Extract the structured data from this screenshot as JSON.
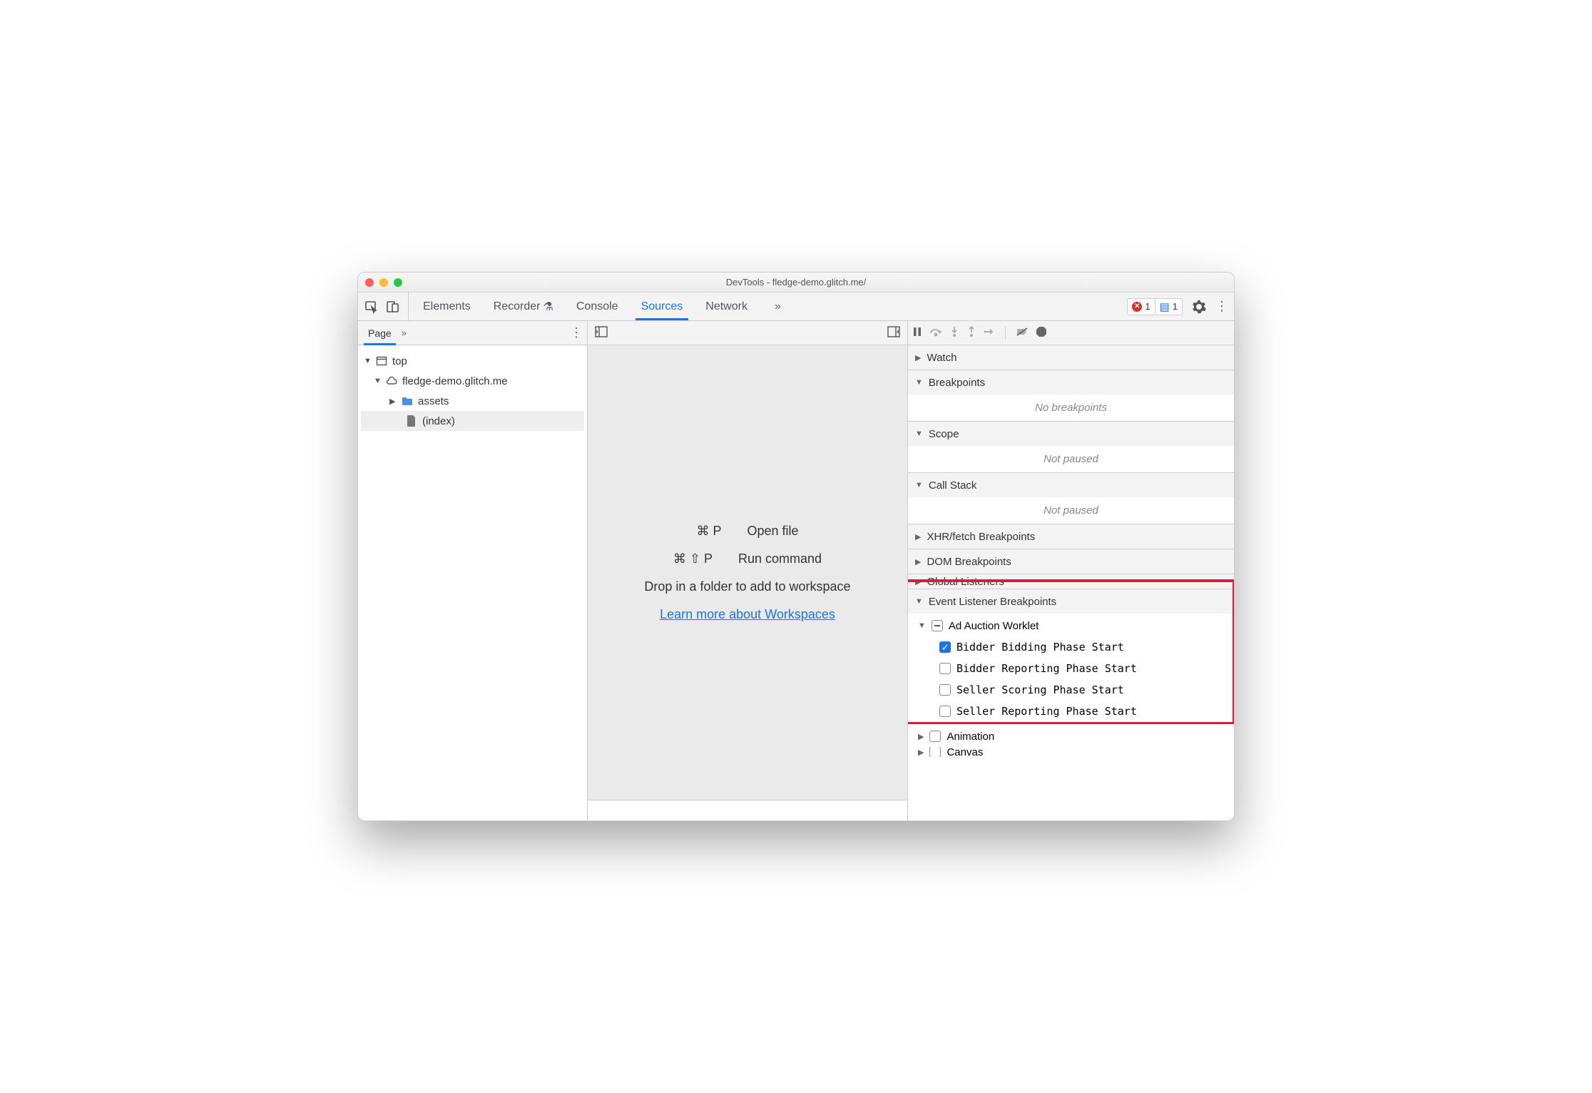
{
  "window": {
    "title": "DevTools - fledge-demo.glitch.me/"
  },
  "toolbar": {
    "tabs": [
      "Elements",
      "Recorder",
      "Console",
      "Sources",
      "Network"
    ],
    "active_tab": "Sources",
    "errors_count": "1",
    "messages_count": "1"
  },
  "left": {
    "tab": "Page",
    "tree": {
      "top": "top",
      "origin": "fledge-demo.glitch.me",
      "folder": "assets",
      "file": "(index)"
    }
  },
  "mid": {
    "open_keys": "⌘ P",
    "open_label": "Open file",
    "run_keys": "⌘ ⇧ P",
    "run_label": "Run command",
    "drop_text": "Drop in a folder to add to workspace",
    "link_text": "Learn more about Workspaces"
  },
  "right": {
    "sections": {
      "watch": "Watch",
      "breakpoints": "Breakpoints",
      "breakpoints_body": "No breakpoints",
      "scope": "Scope",
      "scope_body": "Not paused",
      "callstack": "Call Stack",
      "callstack_body": "Not paused",
      "xhr": "XHR/fetch Breakpoints",
      "dom": "DOM Breakpoints",
      "global": "Global Listeners",
      "evlistener": "Event Listener Breakpoints",
      "ad_auction": "Ad Auction Worklet",
      "events": [
        "Bidder Bidding Phase Start",
        "Bidder Reporting Phase Start",
        "Seller Scoring Phase Start",
        "Seller Reporting Phase Start"
      ],
      "animation": "Animation",
      "canvas": "Canvas"
    }
  }
}
